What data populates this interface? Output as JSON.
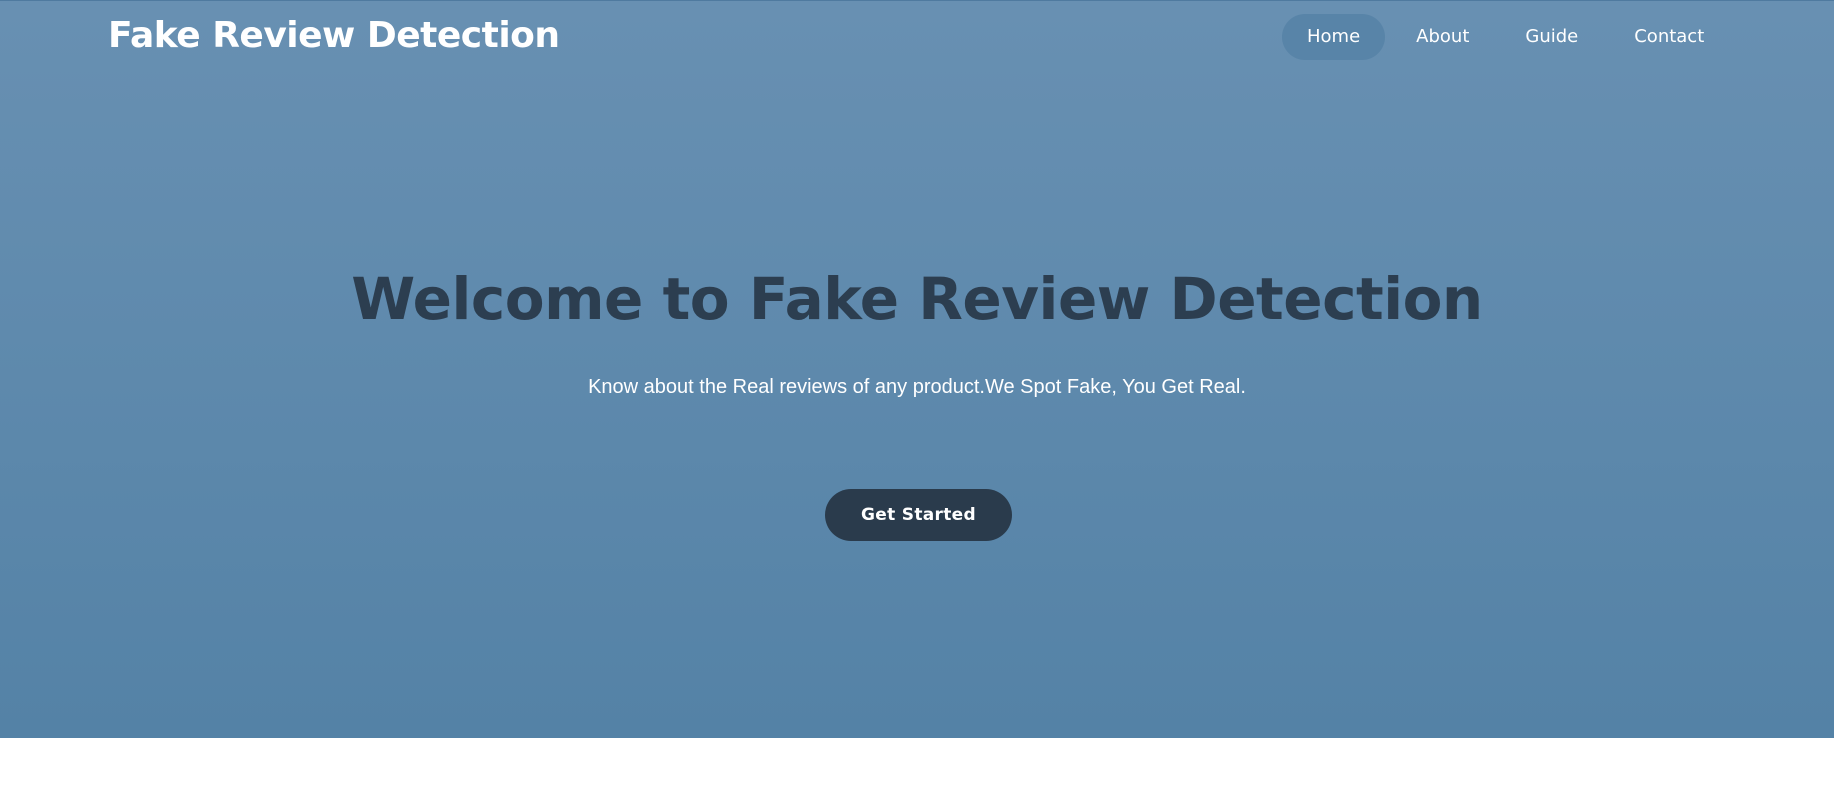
{
  "header": {
    "brand": "Fake Review Detection",
    "nav": [
      {
        "label": "Home",
        "active": true
      },
      {
        "label": "About",
        "active": false
      },
      {
        "label": "Guide",
        "active": false
      },
      {
        "label": "Contact",
        "active": false
      }
    ]
  },
  "hero": {
    "title": "Welcome to Fake Review Detection",
    "subtitle": "Know about the Real reviews of any product.We Spot Fake, You Get Real.",
    "cta_label": "Get Started"
  },
  "colors": {
    "hero_gradient_top": "#6890b2",
    "hero_gradient_bottom": "#5482a6",
    "title_text": "#2c3e50",
    "cta_background": "#2a3b4c",
    "nav_active_pill": "#5884a8"
  }
}
